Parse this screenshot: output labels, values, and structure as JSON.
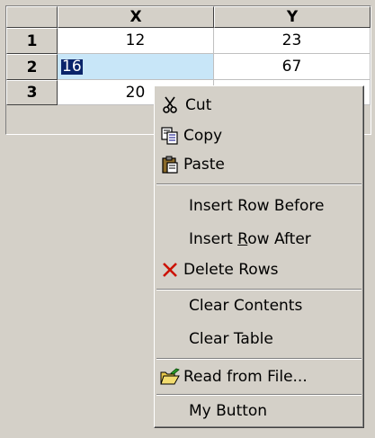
{
  "grid": {
    "columns": [
      "X",
      "Y"
    ],
    "rows": [
      {
        "row": "1",
        "x": "12",
        "y": "23"
      },
      {
        "row": "2",
        "x": "16",
        "y": "67"
      },
      {
        "row": "3",
        "x": "20",
        "y": ""
      }
    ]
  },
  "context_menu": {
    "cut": "Cut",
    "copy": "Copy",
    "paste": "Paste",
    "insert_before": "Insert Row Before",
    "insert_after_pre": "Insert ",
    "insert_after_mnemonic": "R",
    "insert_after_post": "ow After",
    "delete_rows": "Delete Rows",
    "clear_contents": "Clear Contents",
    "clear_table": "Clear Table",
    "read_from_file": "Read from File...",
    "my_button": "My Button"
  },
  "icons": {
    "cut": "scissors-icon",
    "copy": "copy-icon",
    "paste": "clipboard-icon",
    "delete": "delete-x-icon",
    "read": "open-folder-icon"
  },
  "colors": {
    "selection_bg": "#c8e6f8",
    "selection_text_bg": "#0a246a",
    "delete_icon": "#cc1100"
  }
}
